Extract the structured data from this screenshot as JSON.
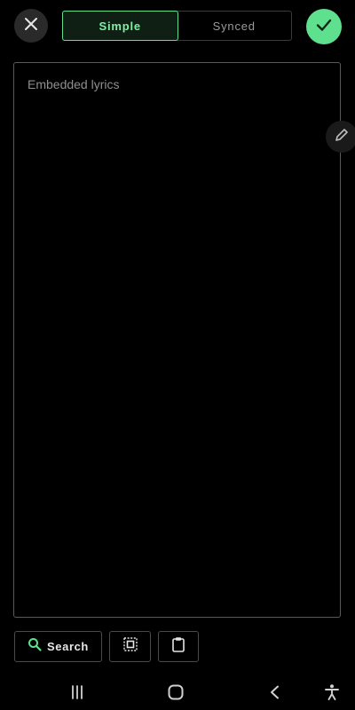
{
  "header": {
    "modes": [
      {
        "label": "Simple",
        "active": true
      },
      {
        "label": "Synced",
        "active": false
      }
    ]
  },
  "editor": {
    "placeholder": "Embedded lyrics",
    "value": ""
  },
  "actions": {
    "search_label": "Search"
  },
  "icons": {
    "close": "close-icon",
    "confirm": "check-icon",
    "edit": "pencil-icon",
    "search": "search-icon",
    "select_all": "select-all-icon",
    "paste": "clipboard-icon",
    "nav_recents": "recents-icon",
    "nav_home": "home-icon",
    "nav_back": "back-icon",
    "accessibility": "accessibility-icon"
  },
  "colors": {
    "accent": "#5fe08e",
    "background": "#000000"
  }
}
